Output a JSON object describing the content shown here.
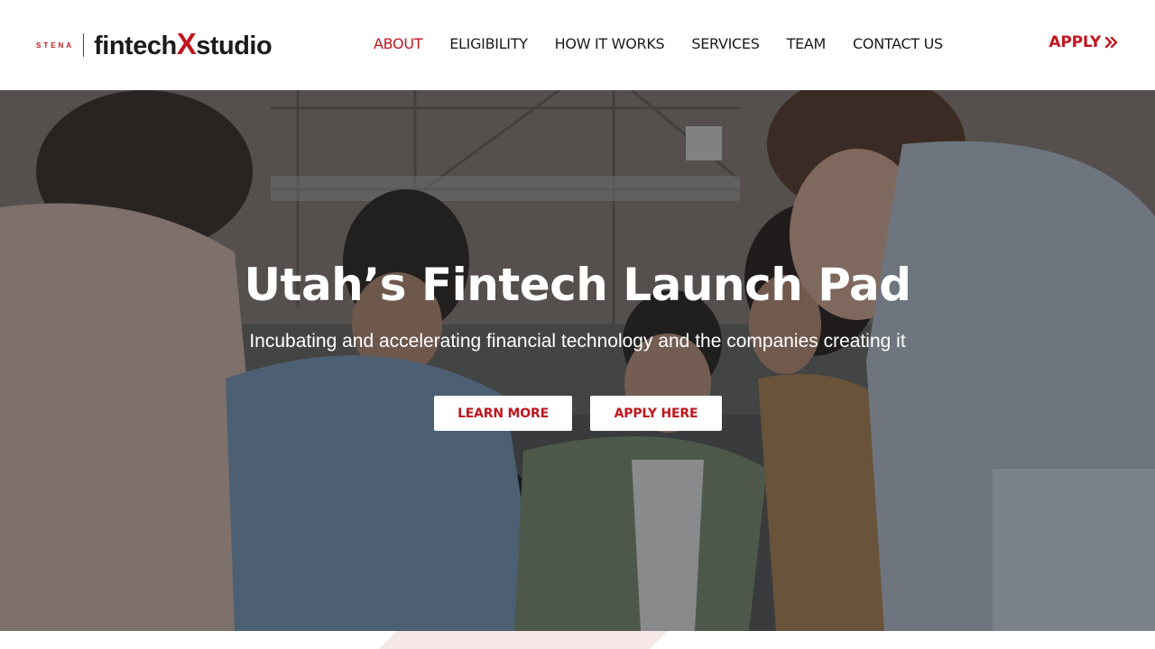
{
  "logo": {
    "stena": "STENA",
    "word_left": "fintech",
    "word_x": "X",
    "word_right": "studio"
  },
  "nav": {
    "items": [
      {
        "label": "ABOUT",
        "active": true
      },
      {
        "label": "ELIGIBILITY",
        "active": false
      },
      {
        "label": "HOW IT WORKS",
        "active": false
      },
      {
        "label": "SERVICES",
        "active": false
      },
      {
        "label": "TEAM",
        "active": false
      },
      {
        "label": "CONTACT US",
        "active": false
      }
    ],
    "apply_label": "APPLY",
    "apply_icon": "double-chevron-right-icon"
  },
  "hero": {
    "title": "Utah’s Fintech Launch Pad",
    "subtitle": "Incubating and accelerating financial technology and the companies creating it",
    "learn_more_label": "LEARN MORE",
    "apply_here_label": "APPLY HERE",
    "background": "team-meeting-photo"
  },
  "colors": {
    "brand_red": "#c0161f",
    "text_dark": "#1b1b1b",
    "white": "#ffffff"
  }
}
